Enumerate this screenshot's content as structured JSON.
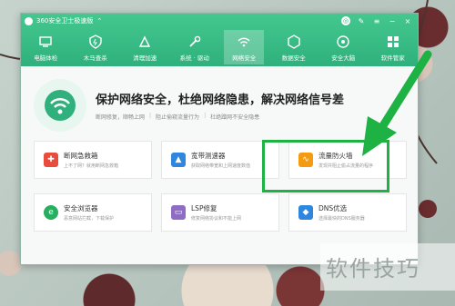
{
  "window": {
    "title": "360安全卫士极速版"
  },
  "tabs": [
    {
      "label": "电脑体检",
      "icon": "computer-check-icon"
    },
    {
      "label": "木马查杀",
      "icon": "shield-icon"
    },
    {
      "label": "清理加速",
      "icon": "broom-icon"
    },
    {
      "label": "系统 · 驱动",
      "icon": "wrench-icon"
    },
    {
      "label": "网络安全",
      "icon": "wifi-icon",
      "active": true
    },
    {
      "label": "数据安全",
      "icon": "cube-icon"
    },
    {
      "label": "安全大脑",
      "icon": "brain-icon"
    },
    {
      "label": "软件管家",
      "icon": "grid-icon"
    }
  ],
  "hero": {
    "title": "保护网络安全，杜绝网络隐患，解决网络信号差",
    "sub": [
      "断网修复，顺畅上网",
      "阻止偷窥流量行为",
      "杜绝蹭网不安全隐患"
    ]
  },
  "cards": [
    {
      "name": "断网急救箱",
      "desc": "上不了网？就用断网急救箱",
      "color": "#e74c3c",
      "icon": "first-aid-icon"
    },
    {
      "name": "宽带测速器",
      "desc": "获取网络带宽和上网速度数值",
      "color": "#2e86de",
      "icon": "speed-icon"
    },
    {
      "name": "流量防火墙",
      "desc": "发现并阻止偷占流量的程序",
      "color": "#f39c12",
      "icon": "firewall-icon"
    },
    {
      "name": "安全浏览器",
      "desc": "恶意网站拦截，下载保护",
      "color": "#27ae60",
      "icon": "browser-icon"
    },
    {
      "name": "LSP修复",
      "desc": "修复网络协议和不能上网",
      "color": "#8e6cc4",
      "icon": "lsp-icon"
    },
    {
      "name": "DNS优选",
      "desc": "选择最快的DNS服务器",
      "color": "#2e86de",
      "icon": "dns-icon"
    }
  ],
  "watermark": "软件技巧",
  "colors": {
    "brand": "#2fb07c",
    "highlight": "#1eb144"
  }
}
